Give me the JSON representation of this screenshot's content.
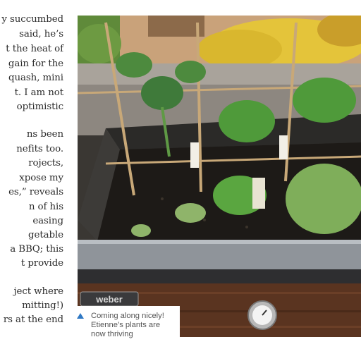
{
  "article": {
    "lines": [
      "y succumbed",
      "said, he’s",
      "t the heat of",
      "gain for the",
      "quash, mini",
      "t. I am not",
      "optimistic",
      "",
      "ns been",
      "nefits too.",
      "rojects,",
      "xpose my",
      "es,” reveals",
      "n of his",
      "easing",
      "getable",
      "a BBQ; this",
      "t provide",
      "",
      "ject where",
      "mitting!)",
      "rs at the end"
    ]
  },
  "photo": {
    "grill_badge_text": "weber"
  },
  "caption": {
    "icon": "triangle-up-icon",
    "accent_color": "#2f78c4",
    "lines": [
      "Coming along nicely!",
      "Etienne’s plants are",
      "now thriving"
    ]
  }
}
